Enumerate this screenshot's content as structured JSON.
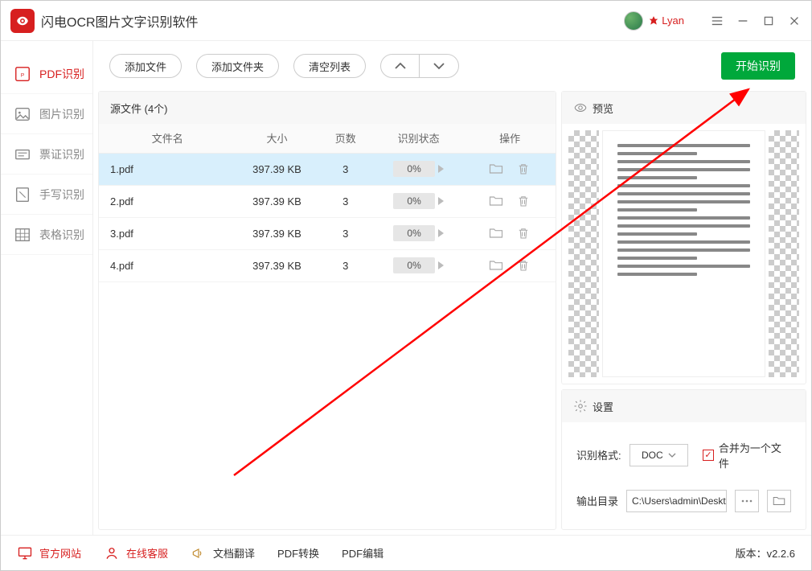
{
  "app": {
    "title": "闪电OCR图片文字识别软件",
    "username": "Lyan"
  },
  "sidebar": {
    "items": [
      {
        "label": "PDF识别",
        "icon": "pdf"
      },
      {
        "label": "图片识别",
        "icon": "image"
      },
      {
        "label": "票证识别",
        "icon": "ticket"
      },
      {
        "label": "手写识别",
        "icon": "handwrite"
      },
      {
        "label": "表格识别",
        "icon": "table"
      }
    ]
  },
  "toolbar": {
    "add_file": "添加文件",
    "add_folder": "添加文件夹",
    "clear_list": "清空列表",
    "start": "开始识别"
  },
  "filelist": {
    "header": "源文件 (4个)",
    "columns": {
      "name": "文件名",
      "size": "大小",
      "pages": "页数",
      "status": "识别状态",
      "ops": "操作"
    },
    "rows": [
      {
        "name": "1.pdf",
        "size": "397.39 KB",
        "pages": "3",
        "progress": "0%",
        "selected": true
      },
      {
        "name": "2.pdf",
        "size": "397.39 KB",
        "pages": "3",
        "progress": "0%",
        "selected": false
      },
      {
        "name": "3.pdf",
        "size": "397.39 KB",
        "pages": "3",
        "progress": "0%",
        "selected": false
      },
      {
        "name": "4.pdf",
        "size": "397.39 KB",
        "pages": "3",
        "progress": "0%",
        "selected": false
      }
    ]
  },
  "preview": {
    "header": "预览"
  },
  "settings": {
    "header": "设置",
    "format_label": "识别格式:",
    "format_value": "DOC",
    "merge_label": "合并为一个文件",
    "output_label": "输出目录",
    "output_value": "C:\\Users\\admin\\Deskto"
  },
  "status": {
    "website": "官方网站",
    "support": "在线客服",
    "doc_translate": "文档翻译",
    "pdf_convert": "PDF转换",
    "pdf_edit": "PDF编辑",
    "version_label": "版本：",
    "version_value": "v2.2.6"
  }
}
